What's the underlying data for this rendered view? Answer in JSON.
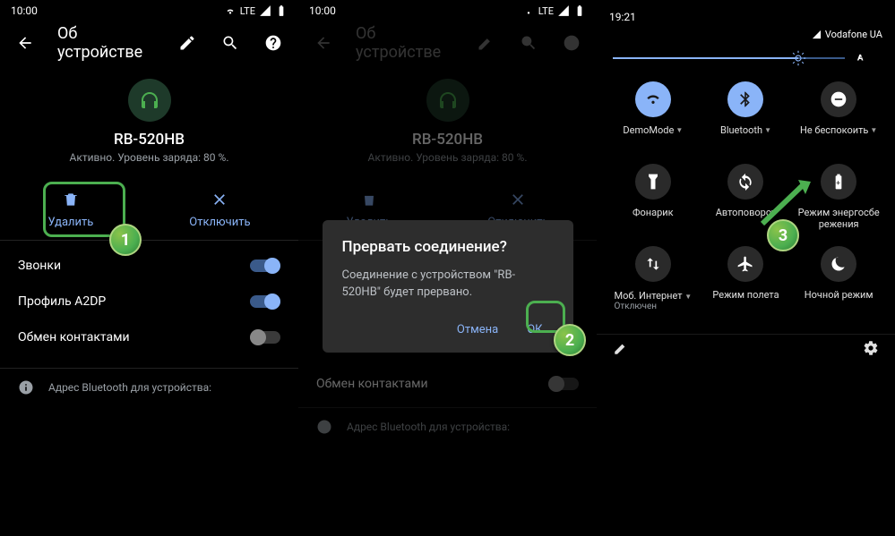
{
  "status": {
    "time": "10:00",
    "lte": "LTE"
  },
  "appbar": {
    "title": "Об устройстве"
  },
  "device": {
    "name": "RB-520HB",
    "status": "Активно. Уровень заряда: 80 %."
  },
  "actions": {
    "delete": "Удалить",
    "disconnect": "Отключить"
  },
  "settings": {
    "calls": "Звонки",
    "a2dp": "Профиль A2DP",
    "contacts": "Обмен контактами"
  },
  "info": {
    "addr_label": "Адрес Bluetooth для устройства:"
  },
  "dialog": {
    "title": "Прервать соединение?",
    "message": "Соединение с устройством \"RB-520HB\" будет прервано.",
    "cancel": "Отмена",
    "ok": "ОК"
  },
  "qs": {
    "time": "19:21",
    "carrier": "Vodafone UA",
    "tiles": {
      "wifi": "DemoMode",
      "bluetooth": "Bluetooth",
      "dnd": "Не беспокоить",
      "flashlight": "Фонарик",
      "rotate": "Автоповорот",
      "battery": "Режим энергосбе\nрежения",
      "data": "Моб. Интернет",
      "data_sub": "Отключен",
      "airplane": "Режим полета",
      "night": "Ночной режим"
    }
  },
  "badges": {
    "b1": "1",
    "b2": "2",
    "b3": "3"
  }
}
